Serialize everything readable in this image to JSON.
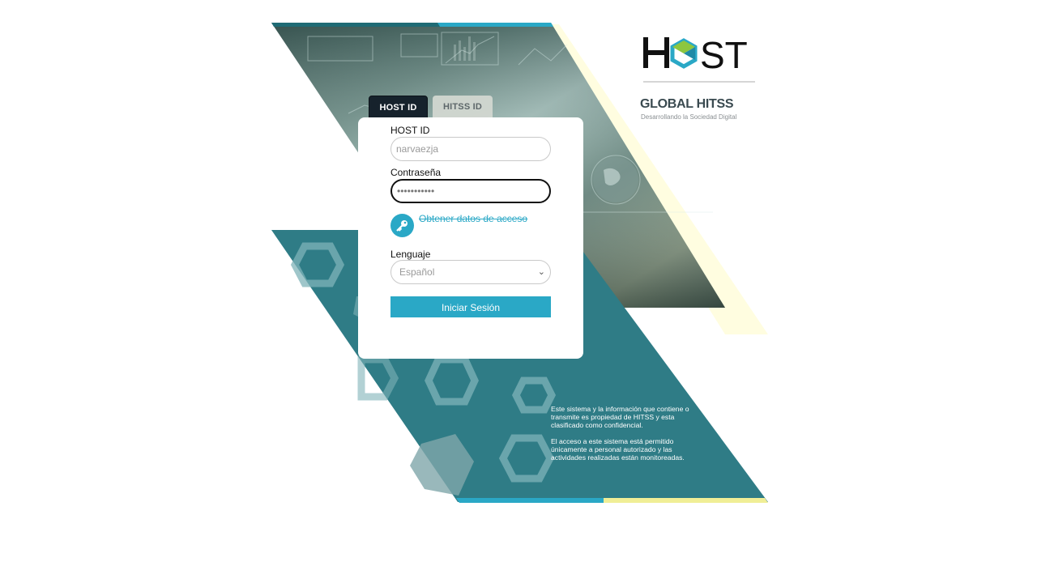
{
  "tabs": {
    "host_id": "HOST ID",
    "hitss_id": "HITSS ID"
  },
  "form": {
    "user_label": "HOST ID",
    "user_value": "narvaezja",
    "password_label": "Contraseña",
    "password_value": "•••••••••••",
    "access_link": "Obtener datos de acceso",
    "language_label": "Lenguaje",
    "language_value": "Español",
    "submit_label": "Iniciar Sesión"
  },
  "branding": {
    "host_logo_text": "HOST",
    "global_hitss_text": "GLOBAL HITSS",
    "tagline": "Desarrollando la Sociedad Digital"
  },
  "notice": {
    "paragraph1": "Este sistema y la información que contiene o transmite es propiedad de HITSS y esta clasificado como confidencial.",
    "paragraph2": "El acceso a este sistema está permitido únicamente a personal autorizado y las actividades realizadas están monitoreadas."
  },
  "colors": {
    "accent": "#2aa8c6",
    "teal_panel": "#2f7c86",
    "tab_dark": "#16222c",
    "yellow_stripe": "#fffde0"
  },
  "icons": {
    "key": "key-icon",
    "chevron": "chevron-down-icon"
  }
}
